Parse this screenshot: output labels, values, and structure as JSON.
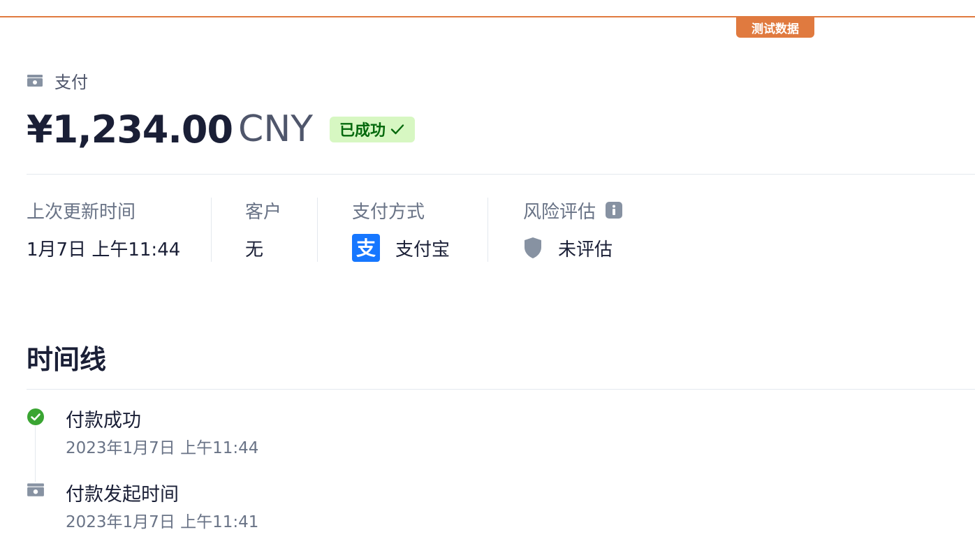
{
  "banner": {
    "test_label": "测试数据"
  },
  "header": {
    "section_label": "支付",
    "amount": "¥1,234.00",
    "currency": "CNY",
    "status": "已成功"
  },
  "meta": {
    "last_updated_label": "上次更新时间",
    "last_updated_value": "1月7日 上午11:44",
    "customer_label": "客户",
    "customer_value": "无",
    "payment_method_label": "支付方式",
    "payment_method_value": "支付宝",
    "payment_method_icon_text": "支",
    "risk_label": "风险评估",
    "risk_value": "未评估"
  },
  "timeline": {
    "title": "时间线",
    "items": [
      {
        "title": "付款成功",
        "time": "2023年1月7日 上午11:44",
        "icon": "check-circle-icon"
      },
      {
        "title": "付款发起时间",
        "time": "2023年1月7日 上午11:41",
        "icon": "payment-icon"
      }
    ]
  },
  "colors": {
    "accent_orange": "#e07a3f",
    "success_bg": "#d7f7c2",
    "success_text": "#05690d",
    "success_icon": "#3aa532",
    "alipay_blue": "#1677ff"
  }
}
